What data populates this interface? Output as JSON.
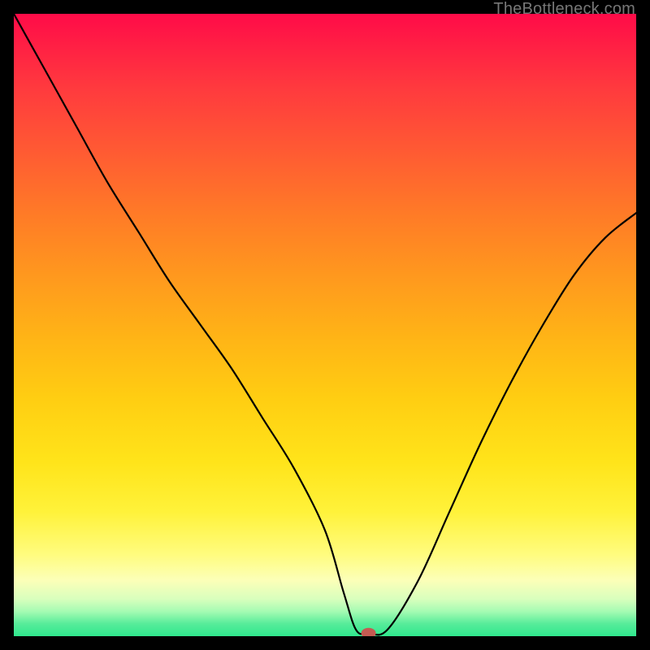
{
  "watermark": "TheBottleneck.com",
  "colors": {
    "curve_stroke": "#000000",
    "marker_fill": "#c55a52",
    "frame_bg": "#000000"
  },
  "chart_data": {
    "type": "line",
    "title": "",
    "xlabel": "",
    "ylabel": "",
    "xlim": [
      0,
      100
    ],
    "ylim": [
      0,
      100
    ],
    "grid": false,
    "series": [
      {
        "name": "bottleneck_curve",
        "x": [
          0,
          5,
          10,
          15,
          20,
          25,
          30,
          35,
          40,
          45,
          50,
          53,
          55,
          57,
          60,
          65,
          70,
          75,
          80,
          85,
          90,
          95,
          100
        ],
        "values": [
          100,
          91,
          82,
          73,
          65,
          57,
          50,
          43,
          35,
          27,
          17,
          7,
          1,
          0.5,
          1,
          9,
          20,
          31,
          41,
          50,
          58,
          64,
          68
        ]
      }
    ],
    "marker": {
      "x": 57,
      "y": 0.5
    }
  }
}
